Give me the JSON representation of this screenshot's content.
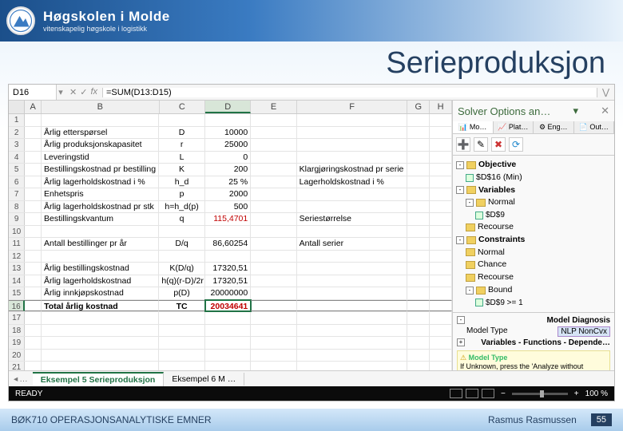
{
  "brand": {
    "title": "Høgskolen i Molde",
    "sub": "vitenskapelig høgskole i logistikk"
  },
  "slide_title": "Serieproduksjon",
  "formula_bar": {
    "cell_ref": "D16",
    "formula": "=SUM(D13:D15)"
  },
  "columns": [
    "A",
    "B",
    "C",
    "D",
    "E",
    "F",
    "G",
    "H"
  ],
  "rows": [
    {
      "n": 1
    },
    {
      "n": 2,
      "b": "Årlig etterspørsel",
      "c": "D",
      "d": "10000"
    },
    {
      "n": 3,
      "b": "Årlig produksjonskapasitet",
      "c": "r",
      "d": "25000"
    },
    {
      "n": 4,
      "b": "Leveringstid",
      "c": "L",
      "d": "0"
    },
    {
      "n": 5,
      "b": "Bestillingskostnad pr bestilling",
      "c": "K",
      "d": "200",
      "f": "Klargjøringskostnad pr serie"
    },
    {
      "n": 6,
      "b": "Årlig lagerholdskostnad i %",
      "c": "h_d",
      "d": "25 %",
      "f": "Lagerholdskostnad i %"
    },
    {
      "n": 7,
      "b": "Enhetspris",
      "c": "p",
      "d": "2000"
    },
    {
      "n": 8,
      "b": "Årlig lagerholdskostnad pr stk",
      "c": "h=h_d(p)",
      "d": "500"
    },
    {
      "n": 9,
      "b": "Bestillingskvantum",
      "c": "q",
      "d": "115,4701",
      "d_red": true,
      "f": "Seriestørrelse"
    },
    {
      "n": 10
    },
    {
      "n": 11,
      "b": "Antall bestillinger pr år",
      "c": "D/q",
      "d": "86,60254",
      "f": "Antall serier"
    },
    {
      "n": 12
    },
    {
      "n": 13,
      "b": "Årlig bestillingskostnad",
      "c": "K(D/q)",
      "d": "17320,51"
    },
    {
      "n": 14,
      "b": "Årlig lagerholdskostnad",
      "c": "h(q)(r-D)/2r",
      "d": "17320,51"
    },
    {
      "n": 15,
      "b": "Årlig innkjøpskostnad",
      "c": "p(D)",
      "d": "20000000"
    },
    {
      "n": 16,
      "b": "Total årlig kostnad",
      "c": "TC",
      "d": "20034641",
      "bold": true,
      "d_red": true,
      "sel": true
    },
    {
      "n": 17
    },
    {
      "n": 18
    },
    {
      "n": 19
    },
    {
      "n": 20
    },
    {
      "n": 21
    }
  ],
  "sheet_tabs": {
    "prev_hint": "…",
    "current": "Eksempel 5 Serieproduksjon",
    "next": "Eksempel 6 M …"
  },
  "status": {
    "ready": "READY",
    "zoom": "100 %"
  },
  "solver": {
    "title": "Solver Options an…",
    "tabs": [
      "Mo…",
      "Plat…",
      "Eng…",
      "Out…"
    ],
    "tree": {
      "objective": {
        "label": "Objective",
        "cell": "$D$16 (Min)"
      },
      "variables": {
        "label": "Variables",
        "normal": "Normal",
        "cell": "$D$9",
        "recourse": "Recourse"
      },
      "constraints": {
        "label": "Constraints",
        "normal": "Normal",
        "chance": "Chance",
        "recourse": "Recourse",
        "bound": "Bound",
        "bcell": "$D$9 >= 1"
      }
    },
    "diag": {
      "header": "Model Diagnosis",
      "type_label": "Model Type",
      "type_value": "NLP NonCvx",
      "section": "Variables - Functions - Depende…",
      "hint_title": "Model Type",
      "hint": "If Unknown, press the 'Analyze without Solving' button to diagnose the model."
    }
  },
  "footer": {
    "left": "BØK710 OPERASJONSANALYTISKE EMNER",
    "right": "Rasmus Rasmussen",
    "num": "55"
  }
}
